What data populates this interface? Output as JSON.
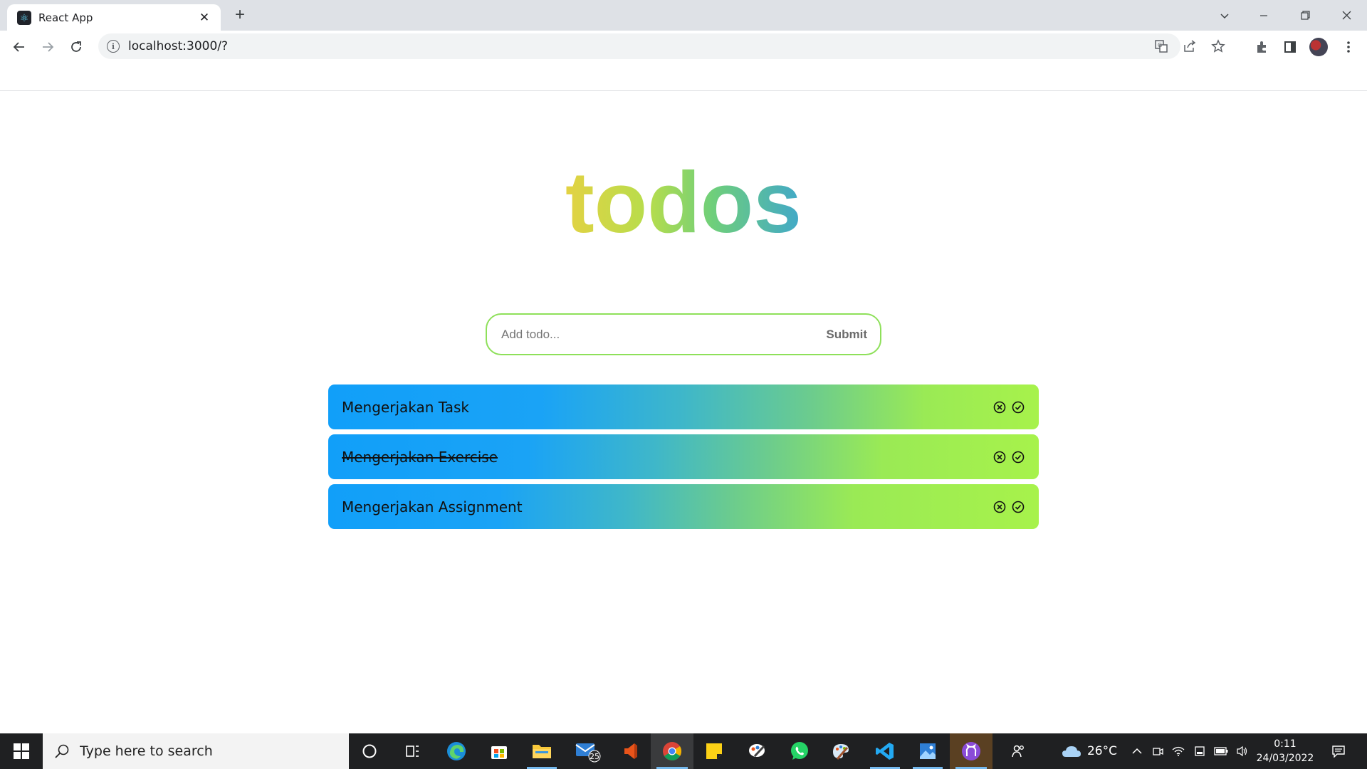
{
  "browser": {
    "tab_title": "React App",
    "tab_icon": "react-icon",
    "new_tab_label": "+",
    "url": "localhost:3000/?"
  },
  "app": {
    "title": "todos",
    "input_placeholder": "Add todo...",
    "input_value": "",
    "submit_label": "Submit",
    "todos": [
      {
        "text": "Mengerjakan Task",
        "done": false
      },
      {
        "text": "Mengerjakan Exercise",
        "done": true
      },
      {
        "text": "Mengerjakan Assignment",
        "done": false
      }
    ]
  },
  "taskbar": {
    "search_placeholder": "Type here to search",
    "mail_badge": "25",
    "weather": "26°C",
    "time": "0:11",
    "date": "24/03/2022"
  },
  "colors": {
    "input_border": "#8ee05a",
    "todo_gradient_start": "#119ff9",
    "todo_gradient_end": "#a7f24b",
    "title_gradient_start": "#e3d243",
    "title_gradient_end": "#41a8c9"
  }
}
